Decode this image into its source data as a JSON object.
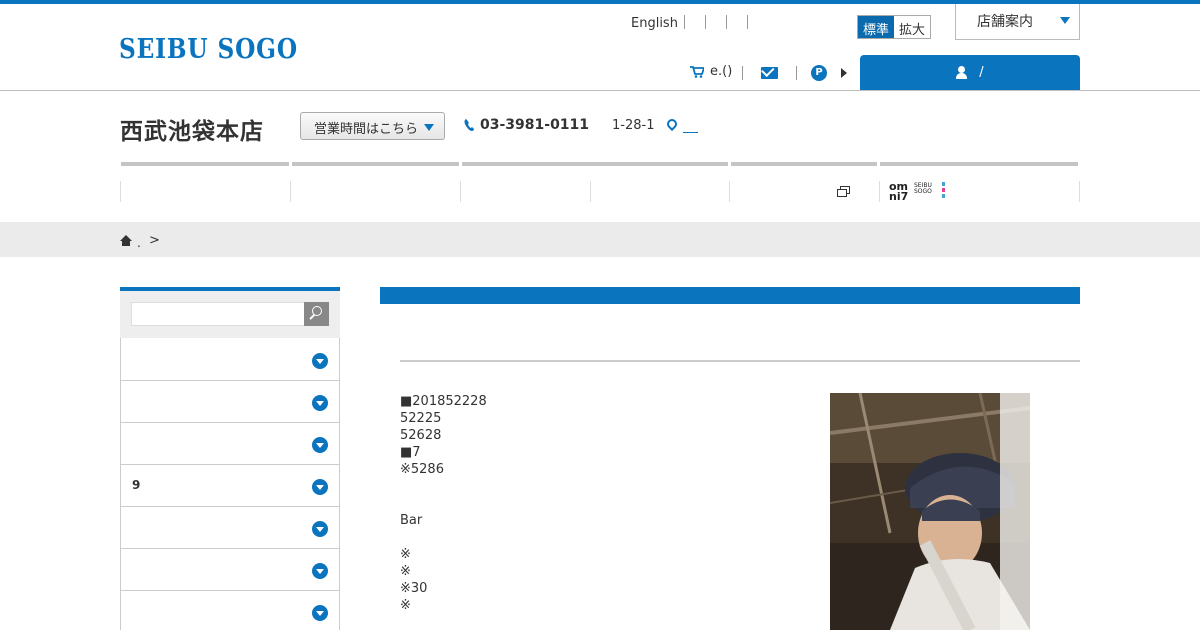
{
  "header": {
    "logo": "SEIBU SOGO",
    "language_link": "English",
    "font_size": {
      "standard": "標準",
      "large": "拡大"
    },
    "store_guide": "店舗案内",
    "cart_label": "e.()",
    "login_label": "/"
  },
  "store": {
    "name": "西武池袋本店",
    "hours_button": "営業時間はこちら",
    "phone": "03-3981-0111",
    "address": "1-28-1"
  },
  "breadcrumb": {
    "dot": ".",
    "separator": ">"
  },
  "sidebar": {
    "items": [
      {
        "label": ""
      },
      {
        "label": ""
      },
      {
        "label": ""
      },
      {
        "label": "9"
      },
      {
        "label": ""
      },
      {
        "label": ""
      },
      {
        "label": ""
      }
    ]
  },
  "omni": {
    "mark": "om ni7",
    "sub": "SEIBU SOGO"
  },
  "content": {
    "text": "■201852228\n52225\n52628\n■7\n※5286\n\n\nBar\n\n※\n※\n※30\n※"
  },
  "colors": {
    "brand": "#0a74bf",
    "accent": "#0a6aad"
  }
}
